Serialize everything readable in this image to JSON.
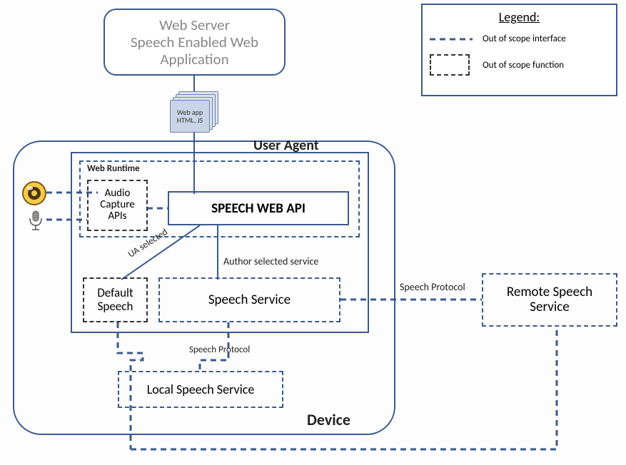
{
  "webserver": {
    "line1": "Web Server",
    "line2": "Speech Enabled Web",
    "line3": "Application"
  },
  "webapp_doc": {
    "line1": "Web app",
    "line2": "HTML, JS"
  },
  "user_agent_label": "User Agent",
  "web_runtime_label": "Web Runtime",
  "audio_capture": {
    "line1": "Audio",
    "line2": "Capture",
    "line3": "APIs"
  },
  "speech_web_api": "SPEECH WEB API",
  "ua_selected": "UA selected",
  "author_selected": "Author selected service",
  "default_speech": {
    "line1": "Default",
    "line2": "Speech"
  },
  "speech_service": "Speech Service",
  "speech_protocol": "Speech Protocol",
  "local_speech_service": "Local Speech Service",
  "device_label": "Device",
  "remote_speech": {
    "line1": "Remote Speech",
    "line2": "Service"
  },
  "legend": {
    "title": "Legend:",
    "interface": "Out of scope interface",
    "function": "Out of scope function"
  },
  "colors": {
    "blue": "#3b5a8f",
    "gray": "#888"
  }
}
